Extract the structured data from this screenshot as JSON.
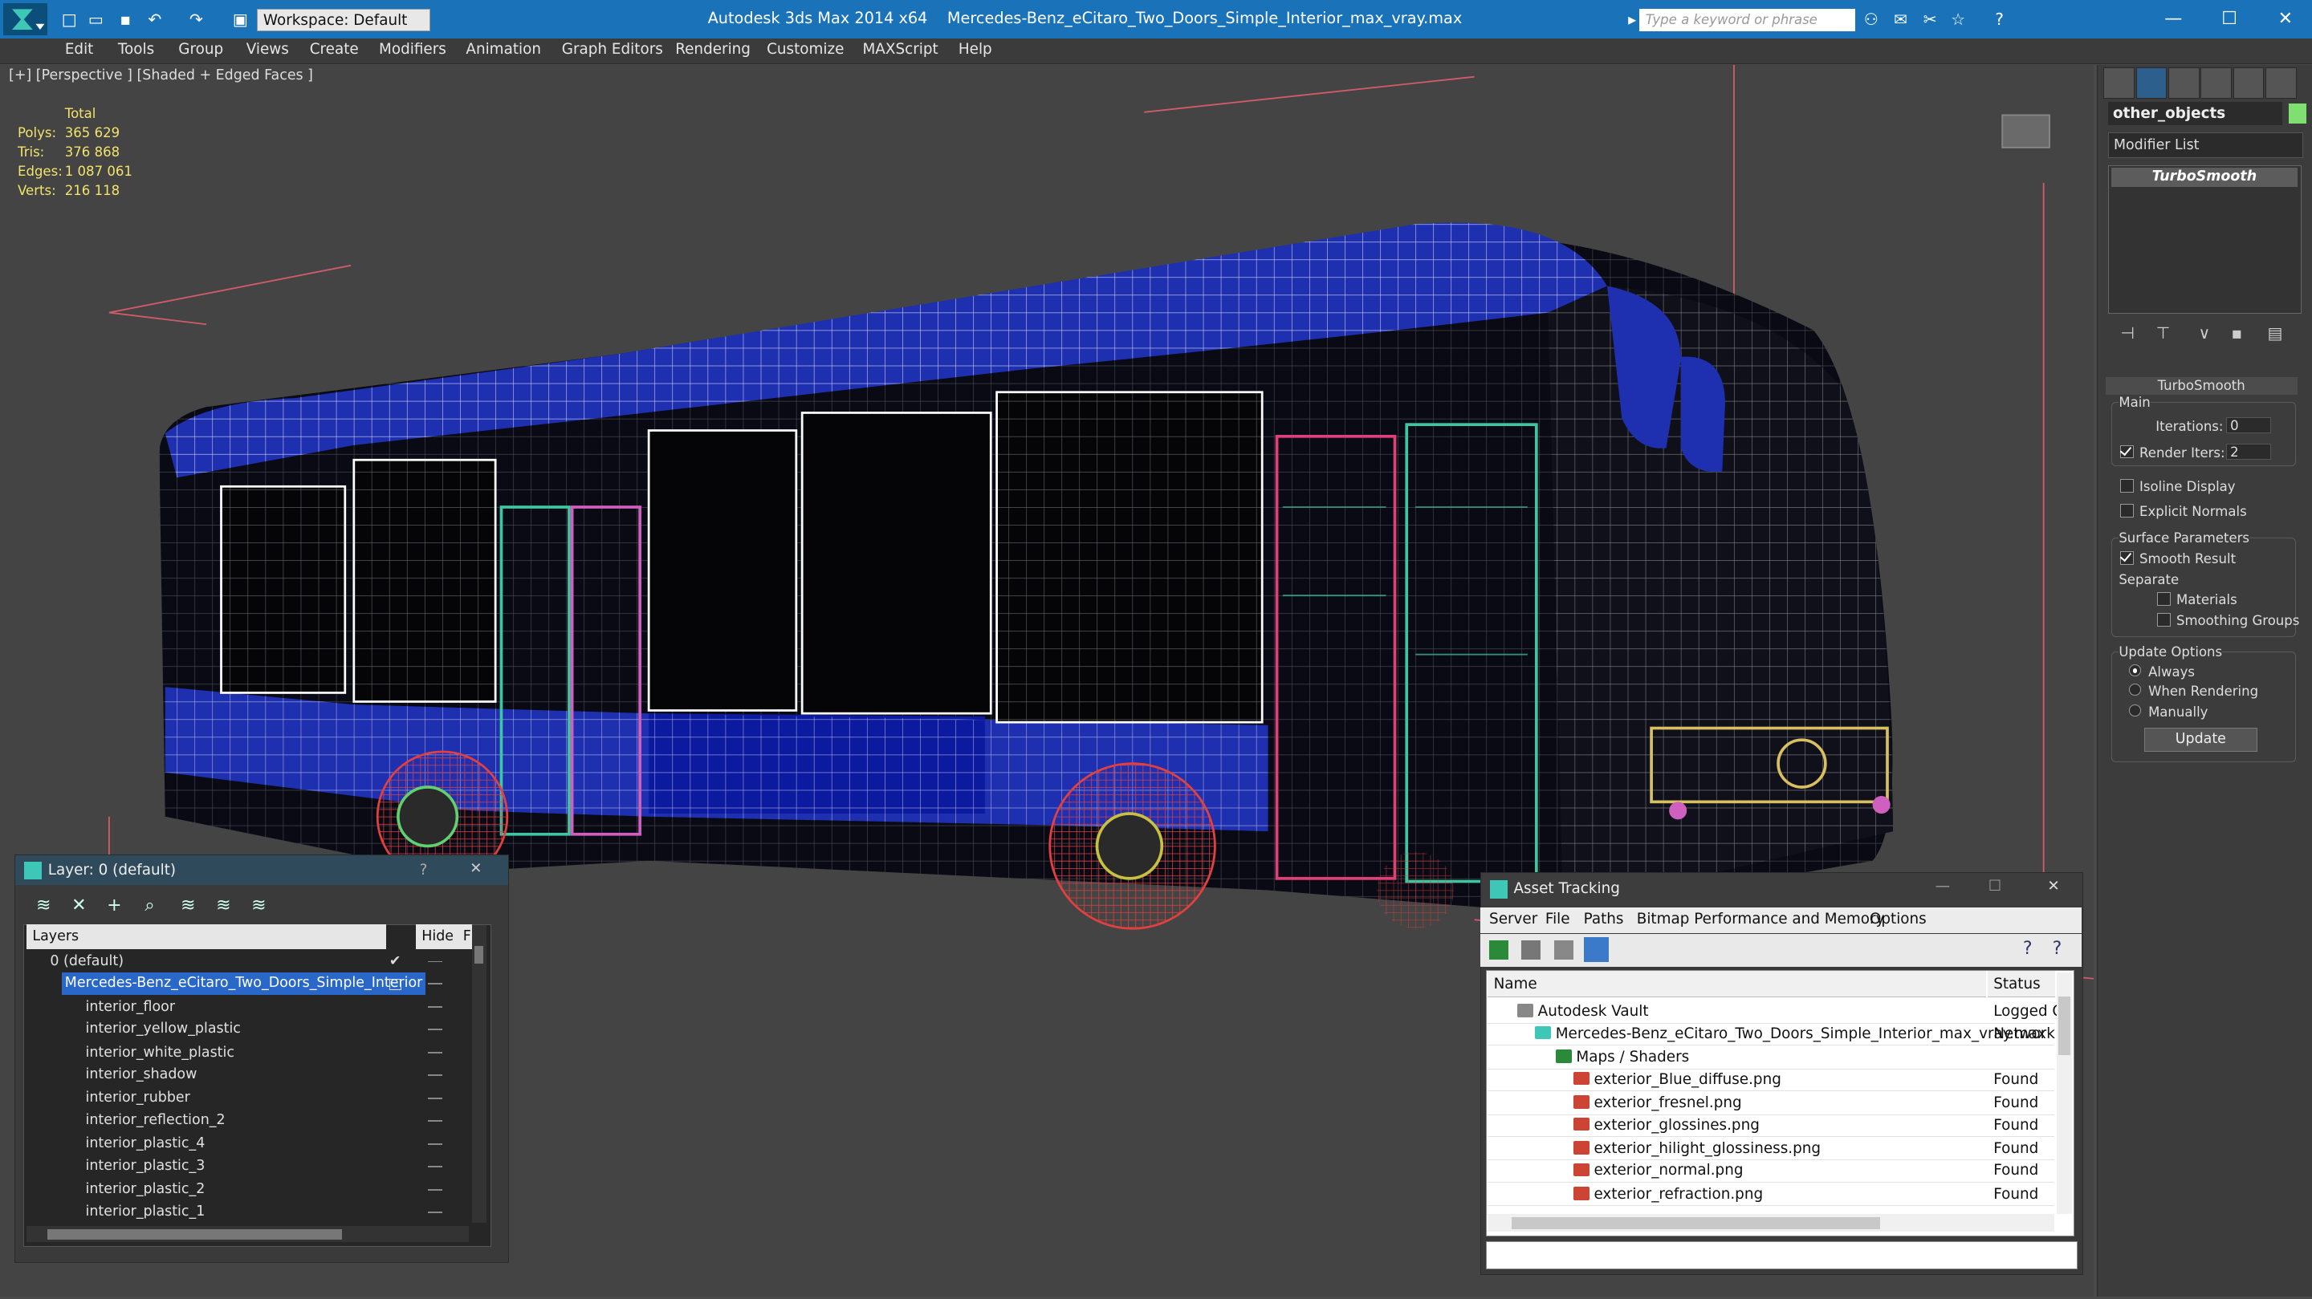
{
  "titlebar": {
    "app": "Autodesk 3ds Max  2014 x64",
    "file": "Mercedes-Benz_eCitaro_Two_Doors_Simple_Interior_max_vray.max",
    "workspace": "Workspace: Default",
    "search_placeholder": "Type a keyword or phrase"
  },
  "menu": [
    "Edit",
    "Tools",
    "Group",
    "Views",
    "Create",
    "Modifiers",
    "Animation",
    "Graph Editors",
    "Rendering",
    "Customize",
    "MAXScript",
    "Help"
  ],
  "viewport": {
    "label": "[+] [Perspective ] [Shaded + Edged Faces ]",
    "stats": {
      "header": "Total",
      "polys_label": "Polys:",
      "polys": "365 629",
      "tris_label": "Tris:",
      "tris": "376 868",
      "edges_label": "Edges:",
      "edges": "1 087 061",
      "verts_label": "Verts:",
      "verts": "216 118"
    }
  },
  "command_panel": {
    "object_name": "other_objects",
    "object_color": "#7ee06e",
    "modifier_list": "Modifier List",
    "stack_item": "TurboSmooth",
    "rollout": "TurboSmooth",
    "main_group": "Main",
    "iterations_label": "Iterations:",
    "iterations": "0",
    "render_iters_label": "Render Iters:",
    "render_iters": "2",
    "isoline": "Isoline Display",
    "explicit_normals": "Explicit Normals",
    "surface_params": "Surface Parameters",
    "smooth_result": "Smooth Result",
    "separate": "Separate",
    "materials": "Materials",
    "smoothing_groups": "Smoothing Groups",
    "update_options": "Update Options",
    "always": "Always",
    "when_rendering": "When Rendering",
    "manually": "Manually",
    "update": "Update"
  },
  "layer_panel": {
    "title": "Layer: 0 (default)",
    "help": "?",
    "close": "✕",
    "col_layers": "Layers",
    "col_hide": "Hide",
    "col_f": "F",
    "rows": [
      "0 (default)",
      "Mercedes-Benz_eCitaro_Two_Doors_Simple_Interior",
      "interior_floor",
      "interior_yellow_plastic",
      "interior_white_plastic",
      "interior_shadow",
      "interior_rubber",
      "interior_reflection_2",
      "interior_plastic_4",
      "interior_plastic_3",
      "interior_plastic_2",
      "interior_plastic_1"
    ]
  },
  "asset_tracking": {
    "title": "Asset Tracking",
    "menu": [
      "Server",
      "File",
      "Paths",
      "Bitmap Performance and Memory",
      "Options"
    ],
    "col_name": "Name",
    "col_status": "Status",
    "rows": [
      {
        "name": "Autodesk Vault",
        "status": "Logged O"
      },
      {
        "name": "Mercedes-Benz_eCitaro_Two_Doors_Simple_Interior_max_vray.max",
        "status": "Network I"
      },
      {
        "name": "Maps / Shaders",
        "status": ""
      },
      {
        "name": "exterior_Blue_diffuse.png",
        "status": "Found"
      },
      {
        "name": "exterior_fresnel.png",
        "status": "Found"
      },
      {
        "name": "exterior_glossines.png",
        "status": "Found"
      },
      {
        "name": "exterior_hilight_glossiness.png",
        "status": "Found"
      },
      {
        "name": "exterior_normal.png",
        "status": "Found"
      },
      {
        "name": "exterior_refraction.png",
        "status": "Found"
      }
    ]
  }
}
